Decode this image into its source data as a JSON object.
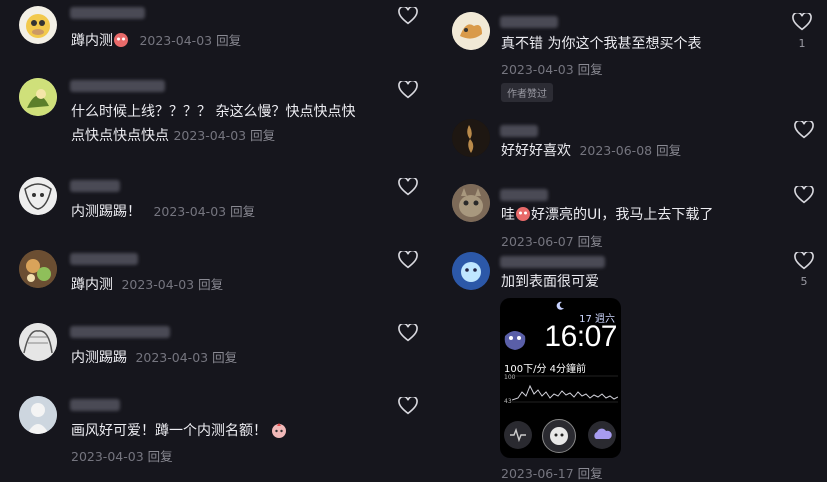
{
  "left_comments": [
    {
      "text": "蹲内测",
      "emoji": true,
      "date": "2023-04-03",
      "reply": "回复",
      "meta_inline": true
    },
    {
      "text_lines": [
        "什么时候上线？？？？ 杂这么慢？快点快点快",
        "点快点快点快点"
      ],
      "date": "2023-04-03",
      "reply": "回复"
    },
    {
      "text": "内测踢踢！",
      "date": "2023-04-03",
      "reply": "回复"
    },
    {
      "text": "蹲内测",
      "date": "2023-04-03",
      "reply": "回复"
    },
    {
      "text": "内测踢踢",
      "date": "2023-04-03",
      "reply": "回复"
    },
    {
      "text": "画风好可爱！蹲一个内测名额！",
      "date": "2023-04-03",
      "reply": "回复"
    }
  ],
  "right_comments": [
    {
      "text": "真不错 为你这个我甚至想买个表",
      "date": "2023-04-03",
      "reply": "回复",
      "likes": "1",
      "badge": "作者赞过"
    },
    {
      "text": "好好好喜欢",
      "date": "2023-06-08",
      "reply": "回复"
    },
    {
      "text_pre": "哇",
      "text_post": "好漂亮的UI，我马上去下载了",
      "date": "2023-06-07",
      "reply": "回复"
    },
    {
      "text": "加到表面很可爱",
      "date": "2023-06-17",
      "reply": "回复",
      "likes": "5"
    }
  ],
  "watch": {
    "date": "17 週六",
    "time": "16:07",
    "heart_rate": "100下/分 4分鐘前",
    "max": "100",
    "min": "43"
  },
  "colors": {
    "bg": "#16161d",
    "text": "#ececf1",
    "meta": "#75757f",
    "accent": "#e86a6a"
  }
}
